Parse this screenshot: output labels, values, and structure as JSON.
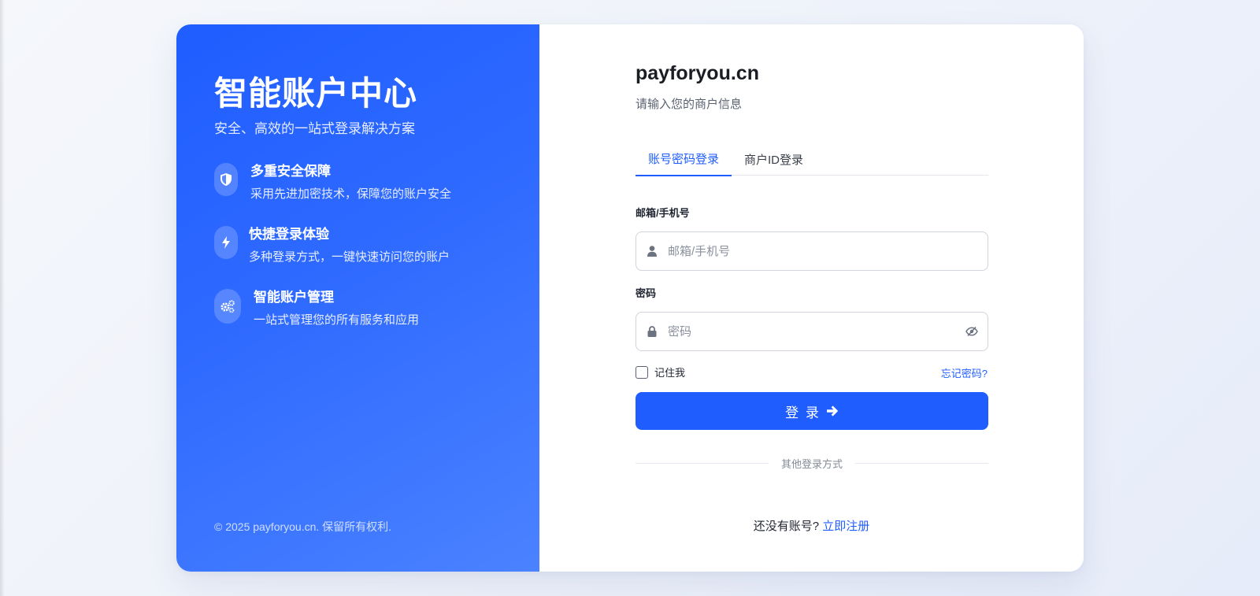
{
  "left_panel": {
    "title": "智能账户中心",
    "subtitle": "安全、高效的一站式登录解决方案",
    "features": [
      {
        "icon": "shield-icon",
        "title": "多重安全保障",
        "desc": "采用先进加密技术，保障您的账户安全"
      },
      {
        "icon": "bolt-icon",
        "title": "快捷登录体验",
        "desc": "多种登录方式，一键快速访问您的账户"
      },
      {
        "icon": "gears-icon",
        "title": "智能账户管理",
        "desc": "一站式管理您的所有服务和应用"
      }
    ],
    "copyright": "© 2025 payforyou.cn. 保留所有权利."
  },
  "login": {
    "site_name": "payforyou.cn",
    "subtitle": "请输入您的商户信息",
    "tabs": [
      {
        "label": "账号密码登录",
        "active": true
      },
      {
        "label": "商户ID登录",
        "active": false
      }
    ],
    "email_label": "邮箱/手机号",
    "email_placeholder": "邮箱/手机号",
    "password_label": "密码",
    "password_placeholder": "密码",
    "remember_label": "记住我",
    "remember_checked": false,
    "forgot_label": "忘记密码?",
    "submit_label": "登 录",
    "divider_text": "其他登录方式",
    "register_prompt": "还没有账号?",
    "register_link": "立即注册"
  },
  "colors": {
    "primary": "#1f5dff",
    "left_gradient_start": "#1f5dff",
    "left_gradient_end": "#4a82ff"
  }
}
